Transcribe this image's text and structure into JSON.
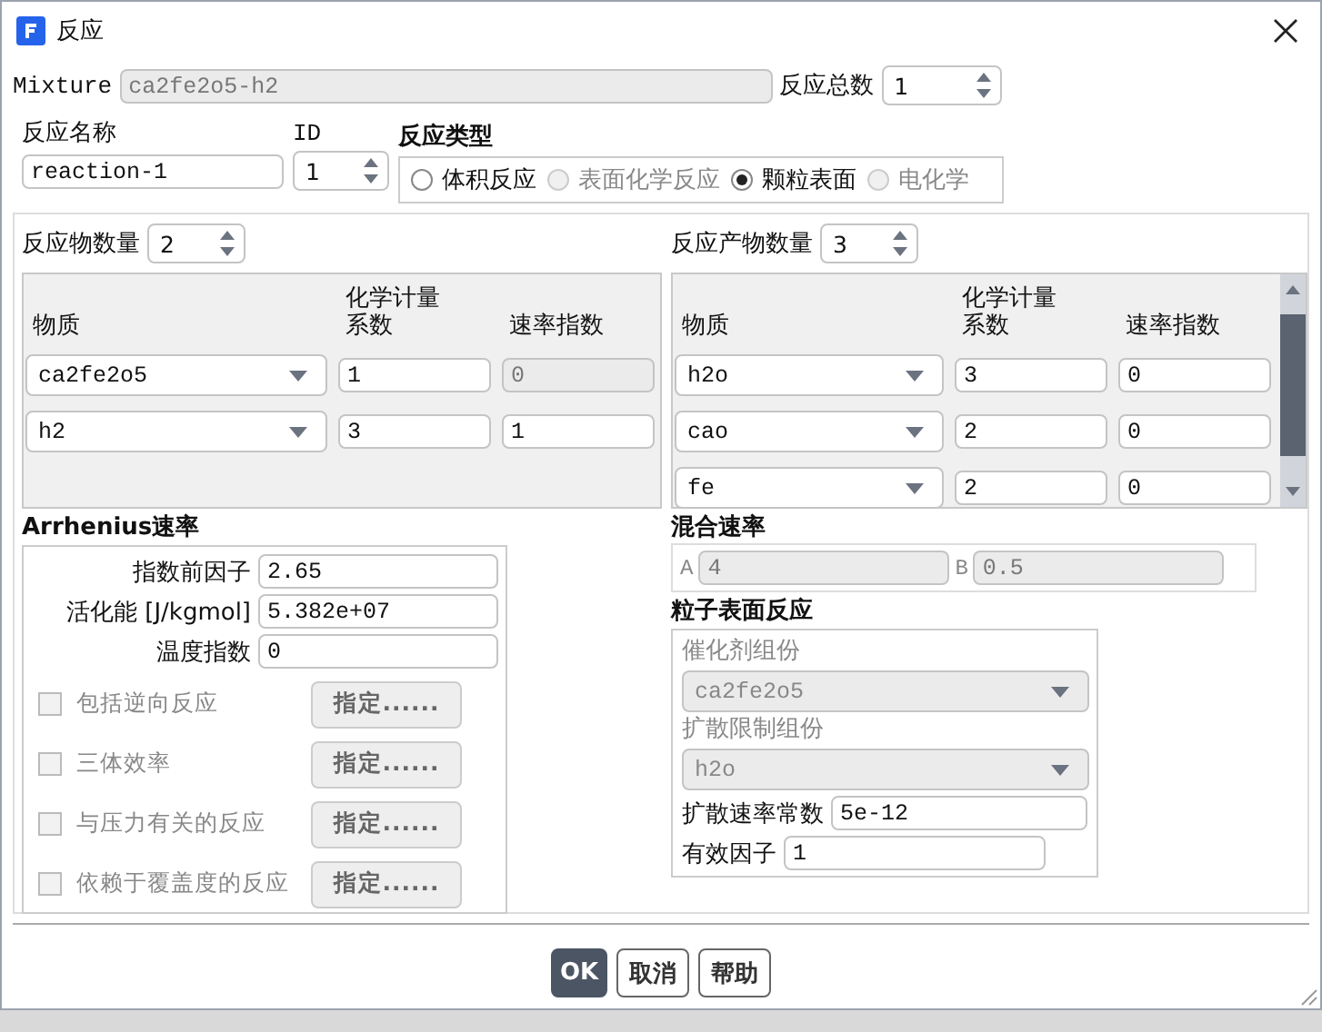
{
  "window": {
    "title": "反应"
  },
  "mixture": {
    "label": "Mixture",
    "value": "ca2fe2o5-h2"
  },
  "reaction_count": {
    "label": "反应总数",
    "value": "1"
  },
  "reaction_name": {
    "label": "反应名称",
    "value": "reaction-1"
  },
  "id": {
    "label": "ID",
    "value": "1"
  },
  "reaction_type": {
    "title": "反应类型",
    "options": [
      {
        "label": "体积反应",
        "selected": false,
        "disabled": false
      },
      {
        "label": "表面化学反应",
        "selected": false,
        "disabled": true
      },
      {
        "label": "颗粒表面",
        "selected": true,
        "disabled": false
      },
      {
        "label": "电化学",
        "selected": false,
        "disabled": true
      }
    ]
  },
  "reactants": {
    "count_label": "反应物数量",
    "count": "2",
    "columns": [
      [
        "物质"
      ],
      [
        "化学计量",
        "系数"
      ],
      [
        "速率指数"
      ]
    ],
    "rows": [
      {
        "species": "ca2fe2o5",
        "stoich": "1",
        "rate_exponent": "0",
        "rate_disabled": true
      },
      {
        "species": "h2",
        "stoich": "3",
        "rate_exponent": "1",
        "rate_disabled": false
      }
    ]
  },
  "products": {
    "count_label": "反应产物数量",
    "count": "3",
    "columns": [
      [
        "物质"
      ],
      [
        "化学计量",
        "系数"
      ],
      [
        "速率指数"
      ]
    ],
    "rows": [
      {
        "species": "h2o",
        "stoich": "3",
        "rate_exponent": "0",
        "rate_disabled": false
      },
      {
        "species": "cao",
        "stoich": "2",
        "rate_exponent": "0",
        "rate_disabled": false
      },
      {
        "species": "fe",
        "stoich": "2",
        "rate_exponent": "0",
        "rate_disabled": false
      }
    ]
  },
  "arrhenius": {
    "title": "Arrhenius速率",
    "fields": [
      {
        "label": "指数前因子",
        "value": "2.65"
      },
      {
        "label": "活化能 [J/kgmol]",
        "value": "5.382e+07"
      },
      {
        "label": "温度指数",
        "value": "0"
      }
    ],
    "options": [
      {
        "label": "包括逆向反应",
        "checked": false,
        "disabled": true,
        "button": "指定......"
      },
      {
        "label": "三体效率",
        "checked": false,
        "disabled": true,
        "button": "指定......"
      },
      {
        "label": "与压力有关的反应",
        "checked": false,
        "disabled": true,
        "button": "指定......"
      },
      {
        "label": "依赖于覆盖度的反应",
        "checked": false,
        "disabled": true,
        "button": "指定......"
      }
    ]
  },
  "mixing_rate": {
    "title": "混合速率",
    "disabled": true,
    "fields": [
      {
        "label": "A",
        "value": "4"
      },
      {
        "label": "B",
        "value": "0.5"
      }
    ]
  },
  "particle_surface": {
    "title": "粒子表面反应",
    "dropdowns_disabled": true,
    "dropdowns": [
      {
        "label": "催化剂组份",
        "value": "ca2fe2o5"
      },
      {
        "label": "扩散限制组份",
        "value": "h2o"
      }
    ],
    "fields": [
      {
        "label": "扩散速率常数",
        "value": "5e-12"
      },
      {
        "label": "有效因子",
        "value": "1"
      }
    ]
  },
  "buttons": [
    {
      "label": "OK",
      "primary": true
    },
    {
      "label": "取消",
      "primary": false
    },
    {
      "label": "帮助",
      "primary": false
    }
  ]
}
